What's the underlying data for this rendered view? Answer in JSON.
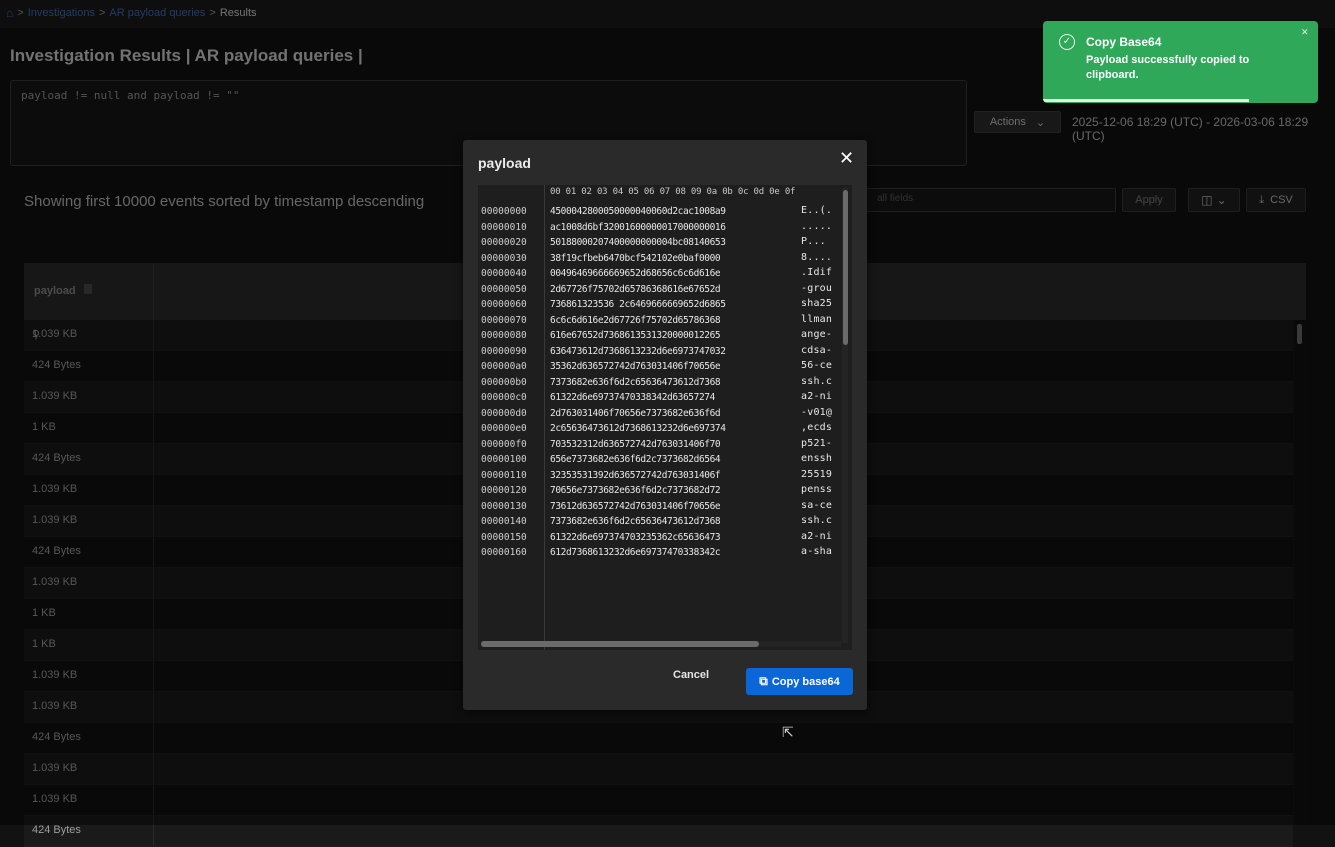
{
  "breadcrumb": {
    "items": [
      "Investigations",
      "AR payload queries"
    ],
    "current": "Results",
    "separator": ">"
  },
  "page": {
    "title": "Investigation Results | AR payload queries |",
    "query": "payload != null and payload != \"\"",
    "actions_label": "Actions",
    "date_range": "2025-12-06 18:29 (UTC) - 2026-03-06 18:29 (UTC)",
    "showing_text": "Showing first 10000 events sorted by timestamp descending",
    "filter_placeholder": "all fields",
    "apply_label": "Apply",
    "csv_label": "CSV"
  },
  "table": {
    "column_header": "payload",
    "rows": [
      "1.039 KB",
      "424 Bytes",
      "1.039 KB",
      "1 KB",
      "424 Bytes",
      "1.039 KB",
      "1.039 KB",
      "424 Bytes",
      "1.039 KB",
      "1 KB",
      "1 KB",
      "1.039 KB",
      "1.039 KB",
      "424 Bytes",
      "1.039 KB",
      "1.039 KB",
      "424 Bytes"
    ]
  },
  "modal": {
    "title": "payload",
    "hex_header": "00 01 02 03 04 05 06 07 08 09 0a 0b 0c 0d 0e 0f",
    "hex_rows": [
      {
        "offset": "00000000",
        "bytes": "4500042800050000040060d2cac1008a9",
        "ascii": "E..(."
      },
      {
        "offset": "00000010",
        "bytes": "ac1008d6bf32001600000017000000016",
        "ascii": "....."
      },
      {
        "offset": "00000020",
        "bytes": "50188000207400000000004bc08140653",
        "ascii": "P..."
      },
      {
        "offset": "00000030",
        "bytes": "38f19cfbeb6470bcf542102e0baf0000",
        "ascii": "8...."
      },
      {
        "offset": "00000040",
        "bytes": "00496469666669652d68656c6c6d616e",
        "ascii": ".Idif"
      },
      {
        "offset": "00000050",
        "bytes": "2d67726f75702d65786368616e67652d",
        "ascii": "-grou"
      },
      {
        "offset": "00000060",
        "bytes": "736861323536 2c6469666669652d6865",
        "ascii": "sha25"
      },
      {
        "offset": "00000070",
        "bytes": "6c6c6d616e2d67726f75702d65786368",
        "ascii": "llman"
      },
      {
        "offset": "00000080",
        "bytes": "616e67652d7368613531320000012265",
        "ascii": "ange-"
      },
      {
        "offset": "00000090",
        "bytes": "636473612d7368613232d6e6973747032",
        "ascii": "cdsa-"
      },
      {
        "offset": "000000a0",
        "bytes": "35362d636572742d763031406f70656e",
        "ascii": "56-ce"
      },
      {
        "offset": "000000b0",
        "bytes": "7373682e636f6d2c65636473612d7368",
        "ascii": "ssh.c"
      },
      {
        "offset": "000000c0",
        "bytes": "61322d6e69737470338342d63657274",
        "ascii": "a2-ni"
      },
      {
        "offset": "000000d0",
        "bytes": "2d763031406f70656e7373682e636f6d",
        "ascii": "-v01@"
      },
      {
        "offset": "000000e0",
        "bytes": "2c65636473612d7368613232d6e697374",
        "ascii": ",ecds"
      },
      {
        "offset": "000000f0",
        "bytes": "703532312d636572742d763031406f70",
        "ascii": "p521-"
      },
      {
        "offset": "00000100",
        "bytes": "656e7373682e636f6d2c7373682d6564",
        "ascii": "enssh"
      },
      {
        "offset": "00000110",
        "bytes": "32353531392d636572742d763031406f",
        "ascii": "25519"
      },
      {
        "offset": "00000120",
        "bytes": "70656e7373682e636f6d2c7373682d72",
        "ascii": "penss"
      },
      {
        "offset": "00000130",
        "bytes": "73612d636572742d763031406f70656e",
        "ascii": "sa-ce"
      },
      {
        "offset": "00000140",
        "bytes": "7373682e636f6d2c65636473612d7368",
        "ascii": "ssh.c"
      },
      {
        "offset": "00000150",
        "bytes": "61322d6e697374703235362c65636473",
        "ascii": "a2-ni"
      },
      {
        "offset": "00000160",
        "bytes": "612d7368613232d6e69737470338342c",
        "ascii": "a-sha"
      }
    ],
    "cancel_label": "Cancel",
    "copy_label": "Copy base64"
  },
  "toast": {
    "title": "Copy Base64",
    "message": "Payload successfully copied to clipboard.",
    "progress_fraction": 0.75,
    "color": "#2fa85a"
  },
  "colors": {
    "accent": "#0b66d6",
    "success": "#2fa85a",
    "background": "#121212"
  },
  "icons": [
    "home-icon",
    "lock-icon",
    "magnify-icon",
    "close-icon",
    "copy-icon",
    "check-circle-icon",
    "columns-icon",
    "download-icon",
    "chevron-down-icon"
  ]
}
